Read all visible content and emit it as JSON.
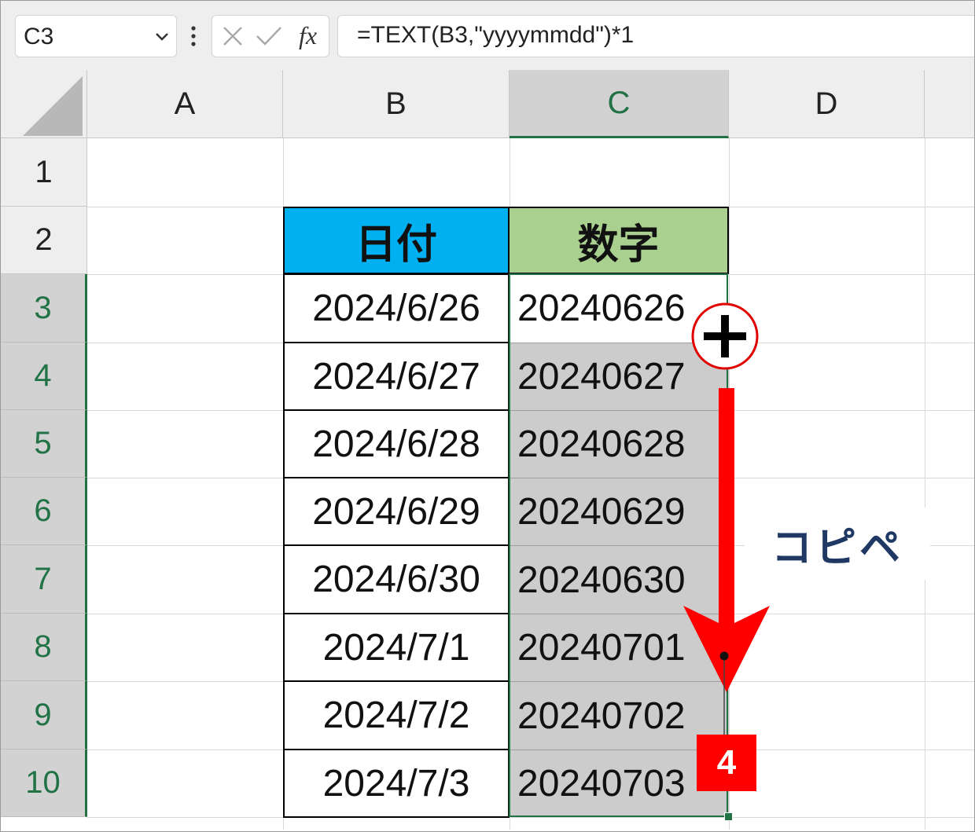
{
  "name_box": {
    "value": "C3"
  },
  "formula_bar": {
    "fx_label": "fx",
    "formula": "=TEXT(B3,\"yyyymmdd\")*1"
  },
  "columns": [
    "A",
    "B",
    "C",
    "D"
  ],
  "rows": [
    "1",
    "2",
    "3",
    "4",
    "5",
    "6",
    "7",
    "8",
    "9",
    "10"
  ],
  "table": {
    "header_date": "日付",
    "header_number": "数字",
    "dates": [
      "2024/6/26",
      "2024/6/27",
      "2024/6/28",
      "2024/6/29",
      "2024/6/30",
      "2024/7/1",
      "2024/7/2",
      "2024/7/3"
    ],
    "numbers": [
      "20240626",
      "20240627",
      "20240628",
      "20240629",
      "20240630",
      "20240701",
      "20240702",
      "20240703"
    ]
  },
  "annotation": {
    "label": "コピペ",
    "step": "4"
  },
  "colors": {
    "header_date_bg": "#00b0f0",
    "header_number_bg": "#a9d08e",
    "selection_fill": "#cccccc",
    "selection_border": "#217346",
    "arrow": "#ff0000",
    "annotation_text": "#1f3864"
  },
  "icons": [
    "chevron-down-icon",
    "vertical-dots-icon",
    "cancel-x-icon",
    "check-icon",
    "fill-handle-plus-icon",
    "down-arrow-icon"
  ]
}
